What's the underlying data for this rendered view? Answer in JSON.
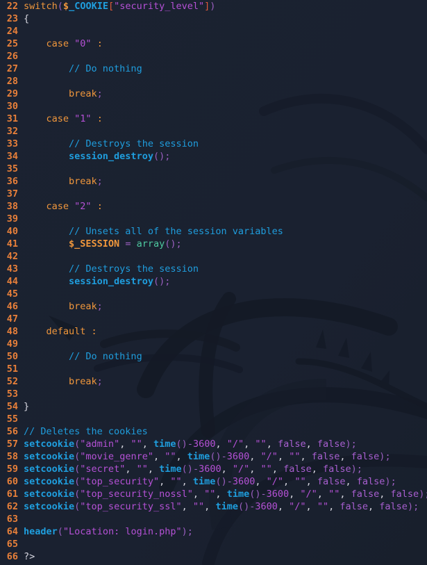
{
  "editor": {
    "language": "php",
    "background_color": "#1a2130",
    "gutter_color": "#e8803a",
    "watermark_icon": "kali-dragon-watermark",
    "first_line_number": 22,
    "last_line_number": 66
  },
  "palette": {
    "keyword": "#f0973c",
    "function": "#1f9ede",
    "string": "#b551d6",
    "comment": "#1f9ede",
    "number": "#b551d6",
    "punctuation": "#d7d7e0",
    "paren": "#9b5fc0",
    "bracket": "#e05a3a",
    "constant": "#a85fd0",
    "array_call": "#4ec9a0"
  },
  "lines": [
    {
      "n": "22",
      "tokens": [
        {
          "t": "switch",
          "c": "t-kw"
        },
        {
          "t": "(",
          "c": "t-paren"
        },
        {
          "t": "$",
          "c": "t-var"
        },
        {
          "t": "_COOKIE",
          "c": "t-varname"
        },
        {
          "t": "[",
          "c": "t-brk"
        },
        {
          "t": "\"security_level\"",
          "c": "t-str"
        },
        {
          "t": "]",
          "c": "t-brk"
        },
        {
          "t": ")",
          "c": "t-paren"
        }
      ]
    },
    {
      "n": "23",
      "tokens": [
        {
          "t": "{",
          "c": "t-punc"
        }
      ]
    },
    {
      "n": "24",
      "tokens": []
    },
    {
      "n": "25",
      "tokens": [
        {
          "t": "    case ",
          "c": "t-kw"
        },
        {
          "t": "\"0\"",
          "c": "t-str"
        },
        {
          "t": " ",
          "c": "t-plain"
        },
        {
          "t": ":",
          "c": "t-kw"
        }
      ]
    },
    {
      "n": "26",
      "tokens": []
    },
    {
      "n": "27",
      "tokens": [
        {
          "t": "        ",
          "c": "t-plain"
        },
        {
          "t": "// Do nothing",
          "c": "t-cmt"
        }
      ]
    },
    {
      "n": "28",
      "tokens": []
    },
    {
      "n": "29",
      "tokens": [
        {
          "t": "        ",
          "c": "t-plain"
        },
        {
          "t": "break",
          "c": "t-kw"
        },
        {
          "t": ";",
          "c": "t-semi"
        }
      ]
    },
    {
      "n": "30",
      "tokens": []
    },
    {
      "n": "31",
      "tokens": [
        {
          "t": "    case ",
          "c": "t-kw"
        },
        {
          "t": "\"1\"",
          "c": "t-str"
        },
        {
          "t": " ",
          "c": "t-plain"
        },
        {
          "t": ":",
          "c": "t-kw"
        }
      ]
    },
    {
      "n": "32",
      "tokens": []
    },
    {
      "n": "33",
      "tokens": [
        {
          "t": "        ",
          "c": "t-plain"
        },
        {
          "t": "// Destroys the session",
          "c": "t-cmt"
        }
      ]
    },
    {
      "n": "34",
      "tokens": [
        {
          "t": "        ",
          "c": "t-plain"
        },
        {
          "t": "session_destroy",
          "c": "t-fn"
        },
        {
          "t": "()",
          "c": "t-paren"
        },
        {
          "t": ";",
          "c": "t-semi"
        }
      ]
    },
    {
      "n": "35",
      "tokens": []
    },
    {
      "n": "36",
      "tokens": [
        {
          "t": "        ",
          "c": "t-plain"
        },
        {
          "t": "break",
          "c": "t-kw"
        },
        {
          "t": ";",
          "c": "t-semi"
        }
      ]
    },
    {
      "n": "37",
      "tokens": []
    },
    {
      "n": "38",
      "tokens": [
        {
          "t": "    case ",
          "c": "t-kw"
        },
        {
          "t": "\"2\"",
          "c": "t-str"
        },
        {
          "t": " ",
          "c": "t-plain"
        },
        {
          "t": ":",
          "c": "t-kw"
        }
      ]
    },
    {
      "n": "39",
      "tokens": []
    },
    {
      "n": "40",
      "tokens": [
        {
          "t": "        ",
          "c": "t-plain"
        },
        {
          "t": "// Unsets all of the session variables",
          "c": "t-cmt"
        }
      ]
    },
    {
      "n": "41",
      "tokens": [
        {
          "t": "        ",
          "c": "t-plain"
        },
        {
          "t": "$_SESSION",
          "c": "t-sessvar"
        },
        {
          "t": " ",
          "c": "t-plain"
        },
        {
          "t": "=",
          "c": "t-op"
        },
        {
          "t": " ",
          "c": "t-plain"
        },
        {
          "t": "array",
          "c": "t-green"
        },
        {
          "t": "()",
          "c": "t-paren"
        },
        {
          "t": ";",
          "c": "t-semi"
        }
      ]
    },
    {
      "n": "42",
      "tokens": []
    },
    {
      "n": "43",
      "tokens": [
        {
          "t": "        ",
          "c": "t-plain"
        },
        {
          "t": "// Destroys the session",
          "c": "t-cmt"
        }
      ]
    },
    {
      "n": "44",
      "tokens": [
        {
          "t": "        ",
          "c": "t-plain"
        },
        {
          "t": "session_destroy",
          "c": "t-fn"
        },
        {
          "t": "()",
          "c": "t-paren"
        },
        {
          "t": ";",
          "c": "t-semi"
        }
      ]
    },
    {
      "n": "45",
      "tokens": []
    },
    {
      "n": "46",
      "tokens": [
        {
          "t": "        ",
          "c": "t-plain"
        },
        {
          "t": "break",
          "c": "t-kw"
        },
        {
          "t": ";",
          "c": "t-semi"
        }
      ]
    },
    {
      "n": "47",
      "tokens": []
    },
    {
      "n": "48",
      "tokens": [
        {
          "t": "    default ",
          "c": "t-kw"
        },
        {
          "t": ":",
          "c": "t-kw"
        }
      ]
    },
    {
      "n": "49",
      "tokens": []
    },
    {
      "n": "50",
      "tokens": [
        {
          "t": "        ",
          "c": "t-plain"
        },
        {
          "t": "// Do nothing",
          "c": "t-cmt"
        }
      ]
    },
    {
      "n": "51",
      "tokens": []
    },
    {
      "n": "52",
      "tokens": [
        {
          "t": "        ",
          "c": "t-plain"
        },
        {
          "t": "break",
          "c": "t-kw"
        },
        {
          "t": ";",
          "c": "t-semi"
        }
      ]
    },
    {
      "n": "53",
      "tokens": []
    },
    {
      "n": "54",
      "tokens": [
        {
          "t": "}",
          "c": "t-punc"
        }
      ]
    },
    {
      "n": "55",
      "tokens": []
    },
    {
      "n": "56",
      "tokens": [
        {
          "t": "// Deletes the cookies",
          "c": "t-cmt"
        }
      ]
    },
    {
      "n": "57",
      "tokens": [
        {
          "t": "setcookie",
          "c": "t-fn"
        },
        {
          "t": "(",
          "c": "t-paren"
        },
        {
          "t": "\"admin\"",
          "c": "t-str"
        },
        {
          "t": ",",
          "c": "t-punc"
        },
        {
          "t": " ",
          "c": "t-plain"
        },
        {
          "t": "\"\"",
          "c": "t-str"
        },
        {
          "t": ",",
          "c": "t-punc"
        },
        {
          "t": " ",
          "c": "t-plain"
        },
        {
          "t": "time",
          "c": "t-fn"
        },
        {
          "t": "()",
          "c": "t-paren"
        },
        {
          "t": "-",
          "c": "t-op"
        },
        {
          "t": "3600",
          "c": "t-num"
        },
        {
          "t": ",",
          "c": "t-punc"
        },
        {
          "t": " ",
          "c": "t-plain"
        },
        {
          "t": "\"/\"",
          "c": "t-str"
        },
        {
          "t": ",",
          "c": "t-punc"
        },
        {
          "t": " ",
          "c": "t-plain"
        },
        {
          "t": "\"\"",
          "c": "t-str"
        },
        {
          "t": ",",
          "c": "t-punc"
        },
        {
          "t": " ",
          "c": "t-plain"
        },
        {
          "t": "false",
          "c": "t-const"
        },
        {
          "t": ",",
          "c": "t-punc"
        },
        {
          "t": " ",
          "c": "t-plain"
        },
        {
          "t": "false",
          "c": "t-const"
        },
        {
          "t": ")",
          "c": "t-paren"
        },
        {
          "t": ";",
          "c": "t-semi"
        }
      ]
    },
    {
      "n": "58",
      "tokens": [
        {
          "t": "setcookie",
          "c": "t-fn"
        },
        {
          "t": "(",
          "c": "t-paren"
        },
        {
          "t": "\"movie_genre\"",
          "c": "t-str"
        },
        {
          "t": ",",
          "c": "t-punc"
        },
        {
          "t": " ",
          "c": "t-plain"
        },
        {
          "t": "\"\"",
          "c": "t-str"
        },
        {
          "t": ",",
          "c": "t-punc"
        },
        {
          "t": " ",
          "c": "t-plain"
        },
        {
          "t": "time",
          "c": "t-fn"
        },
        {
          "t": "()",
          "c": "t-paren"
        },
        {
          "t": "-",
          "c": "t-op"
        },
        {
          "t": "3600",
          "c": "t-num"
        },
        {
          "t": ",",
          "c": "t-punc"
        },
        {
          "t": " ",
          "c": "t-plain"
        },
        {
          "t": "\"/\"",
          "c": "t-str"
        },
        {
          "t": ",",
          "c": "t-punc"
        },
        {
          "t": " ",
          "c": "t-plain"
        },
        {
          "t": "\"\"",
          "c": "t-str"
        },
        {
          "t": ",",
          "c": "t-punc"
        },
        {
          "t": " ",
          "c": "t-plain"
        },
        {
          "t": "false",
          "c": "t-const"
        },
        {
          "t": ",",
          "c": "t-punc"
        },
        {
          "t": " ",
          "c": "t-plain"
        },
        {
          "t": "false",
          "c": "t-const"
        },
        {
          "t": ")",
          "c": "t-paren"
        },
        {
          "t": ";",
          "c": "t-semi"
        }
      ]
    },
    {
      "n": "59",
      "tokens": [
        {
          "t": "setcookie",
          "c": "t-fn"
        },
        {
          "t": "(",
          "c": "t-paren"
        },
        {
          "t": "\"secret\"",
          "c": "t-str"
        },
        {
          "t": ",",
          "c": "t-punc"
        },
        {
          "t": " ",
          "c": "t-plain"
        },
        {
          "t": "\"\"",
          "c": "t-str"
        },
        {
          "t": ",",
          "c": "t-punc"
        },
        {
          "t": " ",
          "c": "t-plain"
        },
        {
          "t": "time",
          "c": "t-fn"
        },
        {
          "t": "()",
          "c": "t-paren"
        },
        {
          "t": "-",
          "c": "t-op"
        },
        {
          "t": "3600",
          "c": "t-num"
        },
        {
          "t": ",",
          "c": "t-punc"
        },
        {
          "t": " ",
          "c": "t-plain"
        },
        {
          "t": "\"/\"",
          "c": "t-str"
        },
        {
          "t": ",",
          "c": "t-punc"
        },
        {
          "t": " ",
          "c": "t-plain"
        },
        {
          "t": "\"\"",
          "c": "t-str"
        },
        {
          "t": ",",
          "c": "t-punc"
        },
        {
          "t": " ",
          "c": "t-plain"
        },
        {
          "t": "false",
          "c": "t-const"
        },
        {
          "t": ",",
          "c": "t-punc"
        },
        {
          "t": " ",
          "c": "t-plain"
        },
        {
          "t": "false",
          "c": "t-const"
        },
        {
          "t": ")",
          "c": "t-paren"
        },
        {
          "t": ";",
          "c": "t-semi"
        }
      ]
    },
    {
      "n": "60",
      "tokens": [
        {
          "t": "setcookie",
          "c": "t-fn"
        },
        {
          "t": "(",
          "c": "t-paren"
        },
        {
          "t": "\"top_security\"",
          "c": "t-str"
        },
        {
          "t": ",",
          "c": "t-punc"
        },
        {
          "t": " ",
          "c": "t-plain"
        },
        {
          "t": "\"\"",
          "c": "t-str"
        },
        {
          "t": ",",
          "c": "t-punc"
        },
        {
          "t": " ",
          "c": "t-plain"
        },
        {
          "t": "time",
          "c": "t-fn"
        },
        {
          "t": "()",
          "c": "t-paren"
        },
        {
          "t": "-",
          "c": "t-op"
        },
        {
          "t": "3600",
          "c": "t-num"
        },
        {
          "t": ",",
          "c": "t-punc"
        },
        {
          "t": " ",
          "c": "t-plain"
        },
        {
          "t": "\"/\"",
          "c": "t-str"
        },
        {
          "t": ",",
          "c": "t-punc"
        },
        {
          "t": " ",
          "c": "t-plain"
        },
        {
          "t": "\"\"",
          "c": "t-str"
        },
        {
          "t": ",",
          "c": "t-punc"
        },
        {
          "t": " ",
          "c": "t-plain"
        },
        {
          "t": "false",
          "c": "t-const"
        },
        {
          "t": ",",
          "c": "t-punc"
        },
        {
          "t": " ",
          "c": "t-plain"
        },
        {
          "t": "false",
          "c": "t-const"
        },
        {
          "t": ")",
          "c": "t-paren"
        },
        {
          "t": ";",
          "c": "t-semi"
        }
      ]
    },
    {
      "n": "61",
      "tokens": [
        {
          "t": "setcookie",
          "c": "t-fn"
        },
        {
          "t": "(",
          "c": "t-paren"
        },
        {
          "t": "\"top_security_nossl\"",
          "c": "t-str"
        },
        {
          "t": ",",
          "c": "t-punc"
        },
        {
          "t": " ",
          "c": "t-plain"
        },
        {
          "t": "\"\"",
          "c": "t-str"
        },
        {
          "t": ",",
          "c": "t-punc"
        },
        {
          "t": " ",
          "c": "t-plain"
        },
        {
          "t": "time",
          "c": "t-fn"
        },
        {
          "t": "()",
          "c": "t-paren"
        },
        {
          "t": "-",
          "c": "t-op"
        },
        {
          "t": "3600",
          "c": "t-num"
        },
        {
          "t": ",",
          "c": "t-punc"
        },
        {
          "t": " ",
          "c": "t-plain"
        },
        {
          "t": "\"/\"",
          "c": "t-str"
        },
        {
          "t": ",",
          "c": "t-punc"
        },
        {
          "t": " ",
          "c": "t-plain"
        },
        {
          "t": "\"\"",
          "c": "t-str"
        },
        {
          "t": ",",
          "c": "t-punc"
        },
        {
          "t": " ",
          "c": "t-plain"
        },
        {
          "t": "false",
          "c": "t-const"
        },
        {
          "t": ",",
          "c": "t-punc"
        },
        {
          "t": " ",
          "c": "t-plain"
        },
        {
          "t": "false",
          "c": "t-const"
        },
        {
          "t": ")",
          "c": "t-paren"
        },
        {
          "t": ";",
          "c": "t-semi"
        }
      ]
    },
    {
      "n": "62",
      "tokens": [
        {
          "t": "setcookie",
          "c": "t-fn"
        },
        {
          "t": "(",
          "c": "t-paren"
        },
        {
          "t": "\"top_security_ssl\"",
          "c": "t-str"
        },
        {
          "t": ",",
          "c": "t-punc"
        },
        {
          "t": " ",
          "c": "t-plain"
        },
        {
          "t": "\"\"",
          "c": "t-str"
        },
        {
          "t": ",",
          "c": "t-punc"
        },
        {
          "t": " ",
          "c": "t-plain"
        },
        {
          "t": "time",
          "c": "t-fn"
        },
        {
          "t": "()",
          "c": "t-paren"
        },
        {
          "t": "-",
          "c": "t-op"
        },
        {
          "t": "3600",
          "c": "t-num"
        },
        {
          "t": ",",
          "c": "t-punc"
        },
        {
          "t": " ",
          "c": "t-plain"
        },
        {
          "t": "\"/\"",
          "c": "t-str"
        },
        {
          "t": ",",
          "c": "t-punc"
        },
        {
          "t": " ",
          "c": "t-plain"
        },
        {
          "t": "\"\"",
          "c": "t-str"
        },
        {
          "t": ",",
          "c": "t-punc"
        },
        {
          "t": " ",
          "c": "t-plain"
        },
        {
          "t": "false",
          "c": "t-const"
        },
        {
          "t": ",",
          "c": "t-punc"
        },
        {
          "t": " ",
          "c": "t-plain"
        },
        {
          "t": "false",
          "c": "t-const"
        },
        {
          "t": ")",
          "c": "t-paren"
        },
        {
          "t": ";",
          "c": "t-semi"
        }
      ]
    },
    {
      "n": "63",
      "tokens": []
    },
    {
      "n": "64",
      "tokens": [
        {
          "t": "header",
          "c": "t-fn"
        },
        {
          "t": "(",
          "c": "t-paren"
        },
        {
          "t": "\"Location: login.php\"",
          "c": "t-str"
        },
        {
          "t": ")",
          "c": "t-paren"
        },
        {
          "t": ";",
          "c": "t-semi"
        }
      ]
    },
    {
      "n": "65",
      "tokens": []
    },
    {
      "n": "66",
      "tokens": [
        {
          "t": "?>",
          "c": "t-tag"
        }
      ]
    }
  ]
}
